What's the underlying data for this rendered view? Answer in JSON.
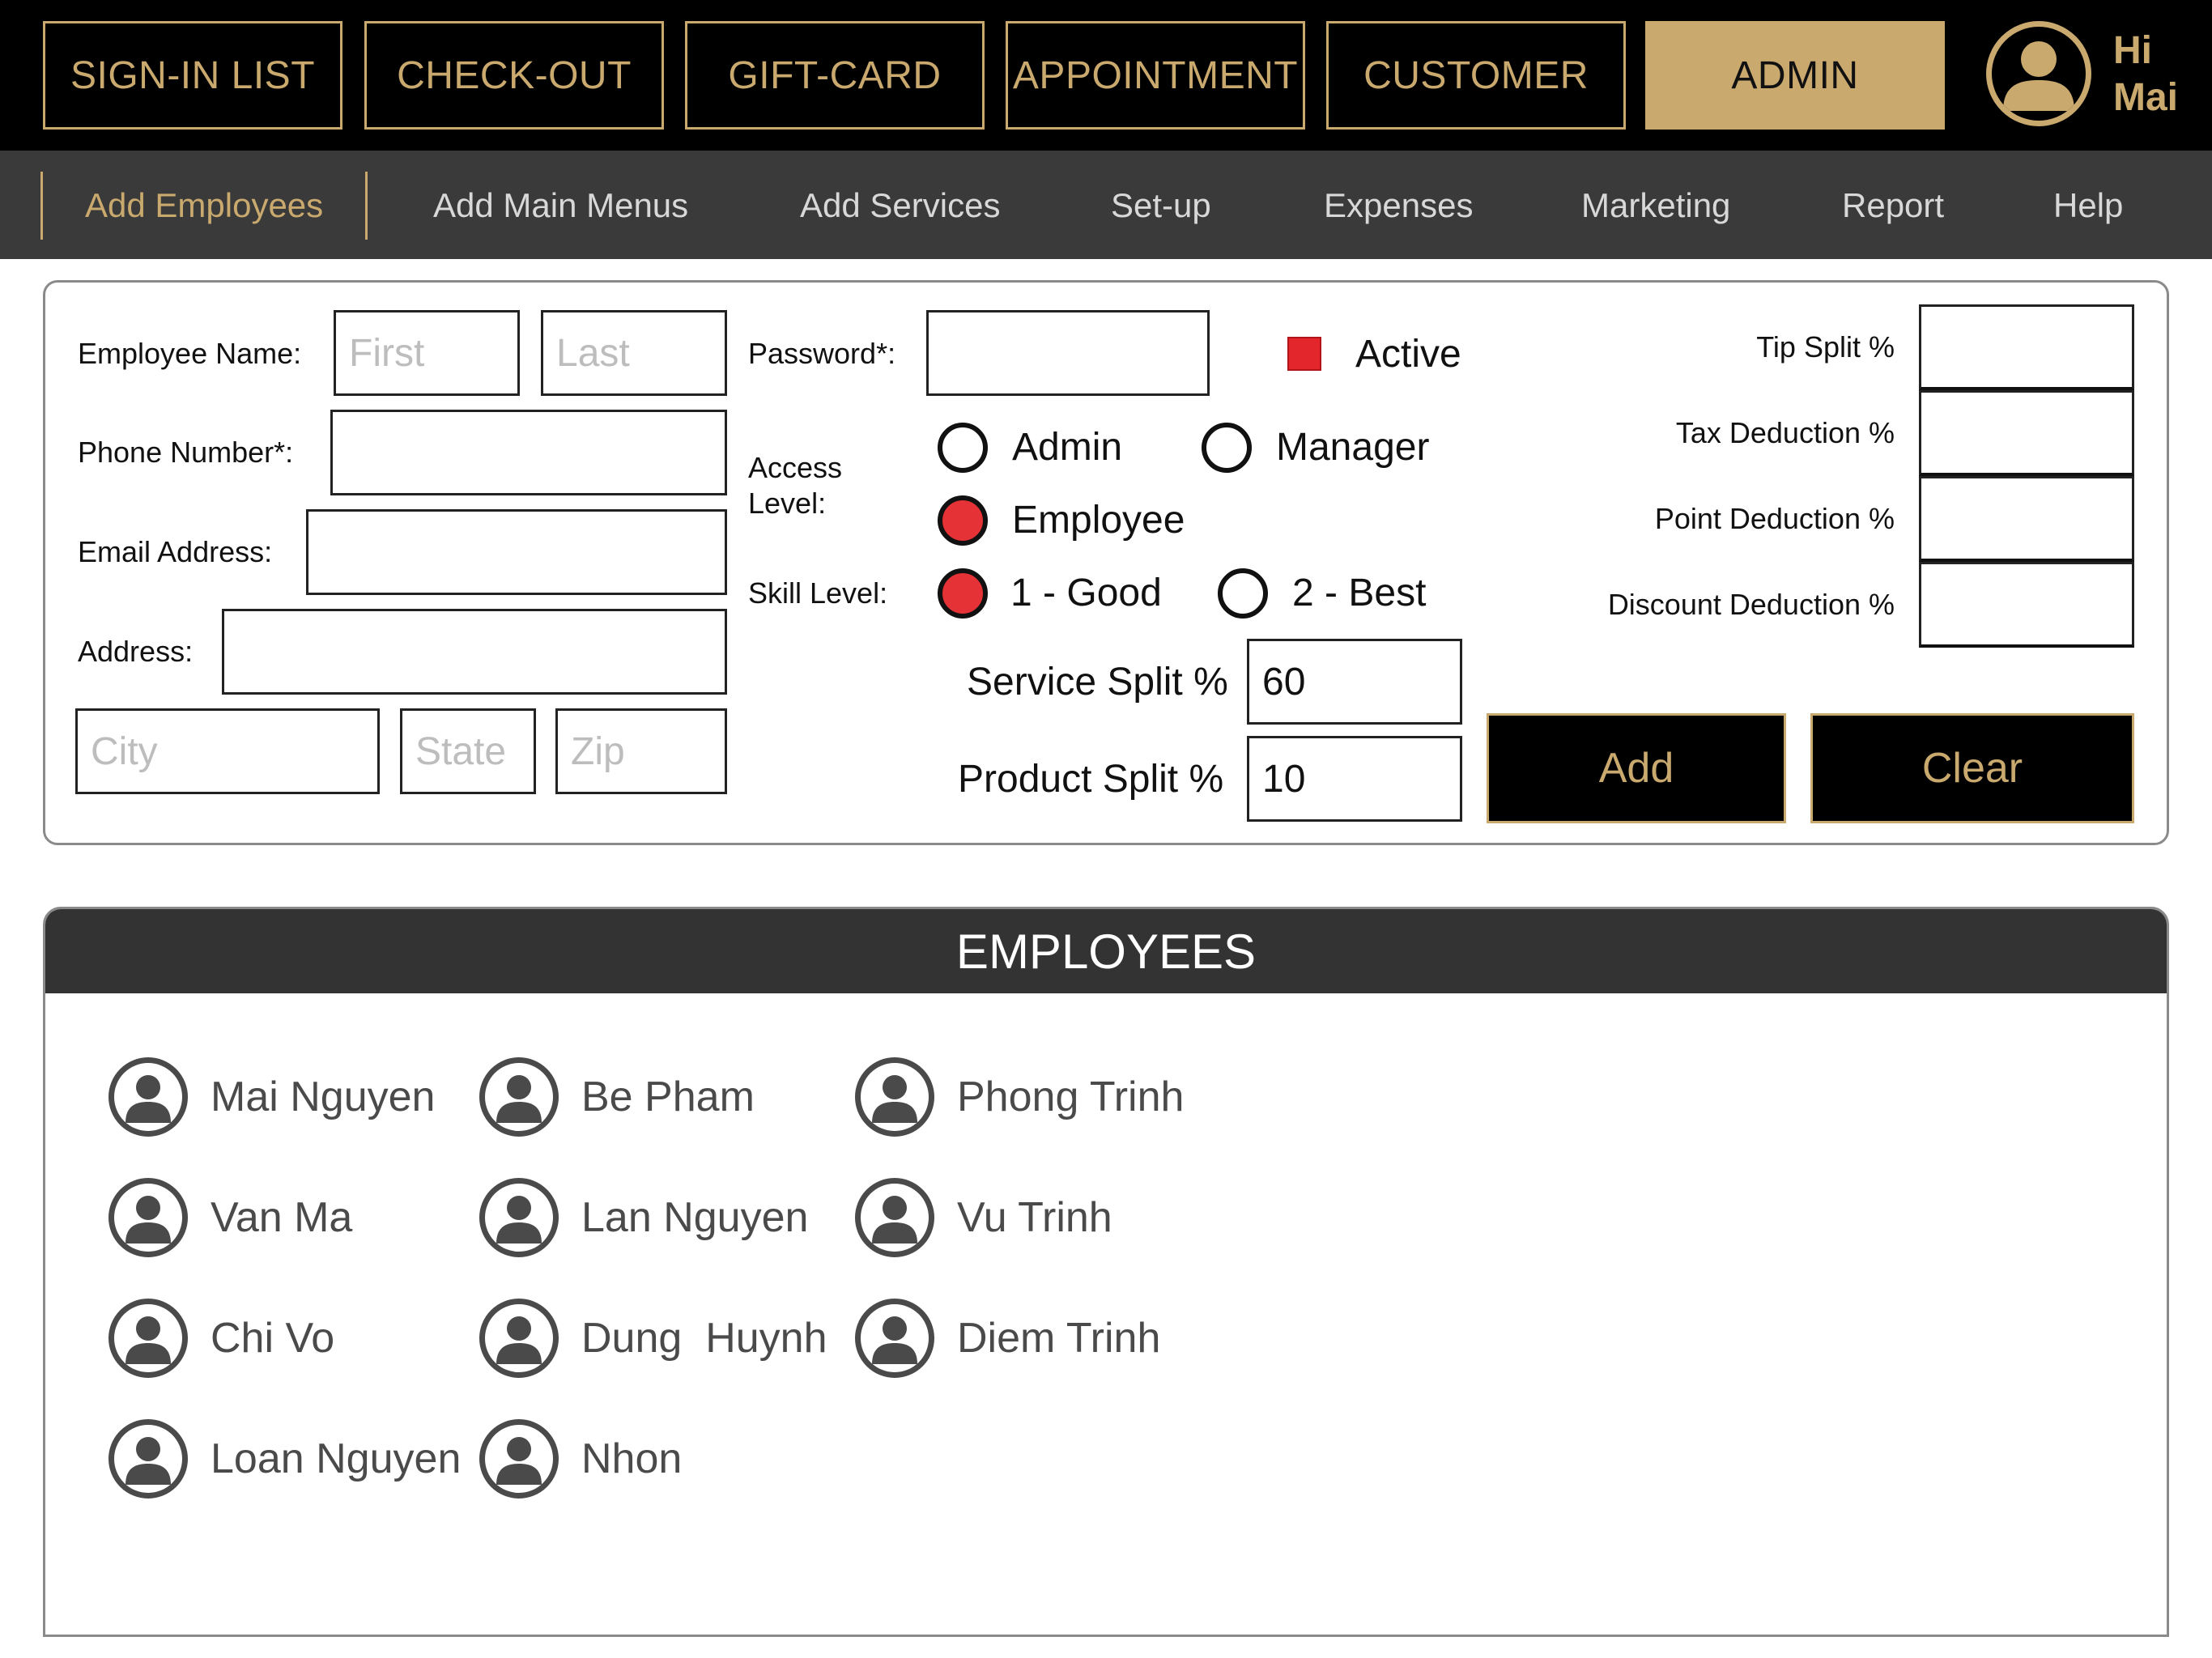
{
  "top_nav": {
    "tabs": [
      {
        "label": "SIGN-IN LIST"
      },
      {
        "label": "CHECK-OUT"
      },
      {
        "label": "GIFT-CARD"
      },
      {
        "label": "APPOINTMENT"
      },
      {
        "label": "CUSTOMER"
      },
      {
        "label": "ADMIN"
      }
    ],
    "active_tab": "ADMIN",
    "greeting_line1": "Hi",
    "greeting_line2": "Mai",
    "avatar_icon": "user-avatar-icon"
  },
  "sub_nav": {
    "items": [
      {
        "label": "Add Employees"
      },
      {
        "label": "Add Main Menus"
      },
      {
        "label": "Add Services"
      },
      {
        "label": "Set-up"
      },
      {
        "label": "Expenses"
      },
      {
        "label": "Marketing"
      },
      {
        "label": "Report"
      },
      {
        "label": "Help"
      }
    ],
    "active_item": "Add Employees"
  },
  "form": {
    "employee_name_label": "Employee Name:",
    "first_placeholder": "First",
    "last_placeholder": "Last",
    "phone_label": "Phone Number*:",
    "email_label": "Email Address:",
    "address_label": "Address:",
    "city_placeholder": "City",
    "state_placeholder": "State",
    "zip_placeholder": "Zip",
    "password_label": "Password*:",
    "active_label": "Active",
    "active_checked": true,
    "access_level_label_1": "Access",
    "access_level_label_2": "Level:",
    "access_options": [
      {
        "label": "Admin",
        "selected": false
      },
      {
        "label": "Manager",
        "selected": false
      },
      {
        "label": "Employee",
        "selected": true
      }
    ],
    "skill_level_label": "Skill Level:",
    "skill_options": [
      {
        "label": "1 - Good",
        "selected": true
      },
      {
        "label": "2 - Best",
        "selected": false
      }
    ],
    "service_split_label": "Service Split %",
    "service_split_value": "60",
    "product_split_label": "Product Split %",
    "product_split_value": "10",
    "tip_split_label": "Tip Split %",
    "tax_deduction_label": "Tax Deduction %",
    "point_deduction_label": "Point Deduction %",
    "discount_deduction_label": "Discount Deduction %",
    "add_label": "Add",
    "clear_label": "Clear"
  },
  "employees": {
    "title": "EMPLOYEES",
    "list": [
      {
        "name": "Mai Nguyen"
      },
      {
        "name": "Van Ma"
      },
      {
        "name": "Chi Vo"
      },
      {
        "name": "Loan Nguyen"
      },
      {
        "name": "Be Pham"
      },
      {
        "name": "Lan Nguyen"
      },
      {
        "name": "Dung  Huynh"
      },
      {
        "name": "Nhon"
      },
      {
        "name": "Phong Trinh"
      },
      {
        "name": "Vu Trinh"
      },
      {
        "name": "Diem Trinh"
      }
    ]
  },
  "colors": {
    "gold": "#c9a96e",
    "black": "#000000",
    "subnav_bg": "#3a3a3a",
    "selected_red": "#e53236"
  }
}
